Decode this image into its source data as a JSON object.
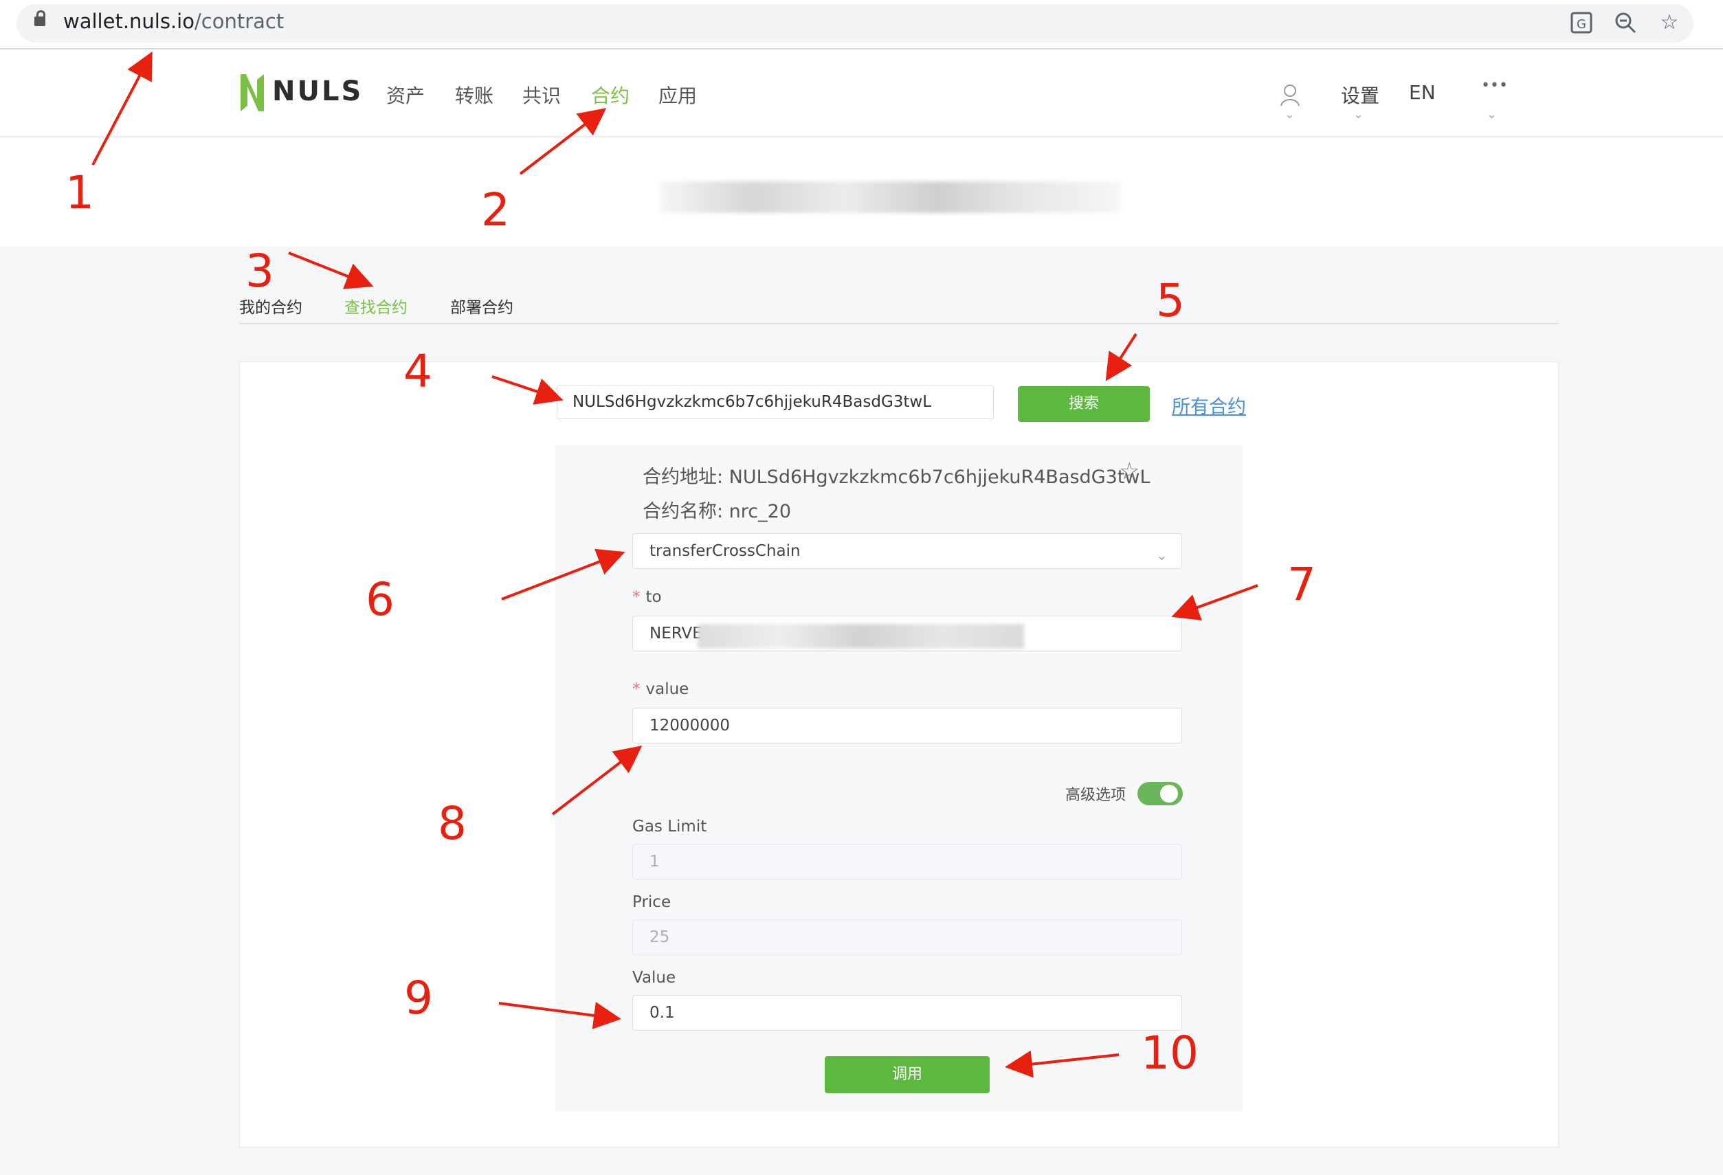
{
  "browser": {
    "url_host": "wallet.nuls.io",
    "url_path": "/contract",
    "icons": [
      "lock-icon",
      "translate-icon",
      "zoom-icon",
      "bookmark-star-icon"
    ]
  },
  "header": {
    "logo_text": "NULS",
    "nav": [
      "资产",
      "转账",
      "共识",
      "合约",
      "应用"
    ],
    "active_nav": "合约",
    "settings_label": "设置",
    "language_label": "EN",
    "more_label": "•••"
  },
  "subtabs": {
    "items": [
      "我的合约",
      "查找合约",
      "部署合约"
    ],
    "active": "查找合约"
  },
  "search": {
    "value": "NULSd6Hgvzkzkmc6b7c6hjjekuR4BasdG3twL",
    "button_label": "搜索",
    "all_contracts_label": "所有合约"
  },
  "contract": {
    "address_line": "合约地址: NULSd6Hgvzkzkmc6b7c6hjjekuR4BasdG3twL",
    "name_line": "合约名称: nrc_20",
    "method": "transferCrossChain",
    "to_label": "to",
    "to_value": "NERVE",
    "value_label": "value",
    "value": "12000000",
    "advanced_label": "高级选项",
    "advanced_enabled": true,
    "gas_limit_label": "Gas Limit",
    "gas_limit": "1",
    "price_label": "Price",
    "price": "25",
    "amount_label": "Value",
    "amount": "0.1",
    "invoke_label": "调用"
  },
  "annotations": [
    "1",
    "2",
    "3",
    "4",
    "5",
    "6",
    "7",
    "8",
    "9",
    "10"
  ],
  "colors": {
    "brand_green": "#7ac143",
    "button_green": "#5cb83f",
    "link_blue": "#4a90e2",
    "annotation_red": "#e8200f"
  }
}
